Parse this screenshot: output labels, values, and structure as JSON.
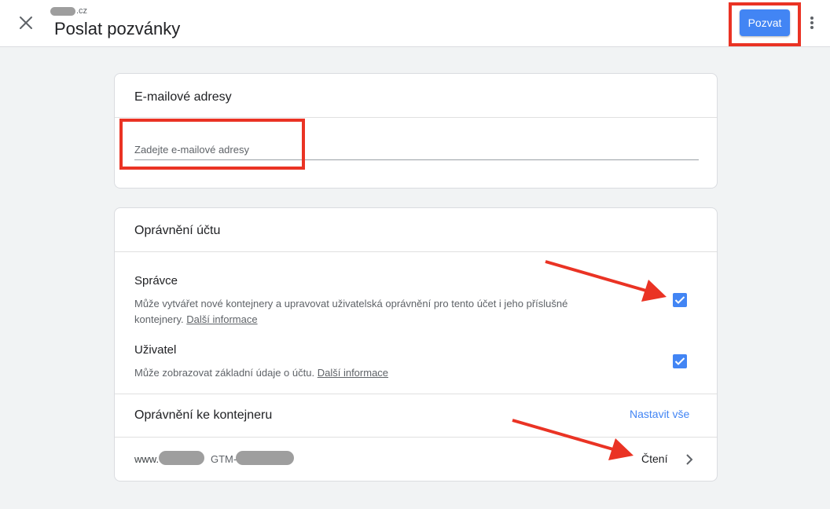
{
  "header": {
    "account_suffix": ".cz",
    "title": "Poslat pozvánky",
    "invite_label": "Pozvat"
  },
  "emails": {
    "title": "E-mailové adresy",
    "placeholder": "Zadejte e-mailové adresy"
  },
  "account_permissions": {
    "title": "Oprávnění účtu",
    "roles": [
      {
        "name": "Správce",
        "description": "Může vytvářet nové kontejnery a upravovat uživatelská oprávnění pro tento účet i jeho příslušné kontejnery.",
        "link": "Další informace",
        "checked": true
      },
      {
        "name": "Uživatel",
        "description": "Může zobrazovat základní údaje o účtu.",
        "link": "Další informace",
        "checked": true
      }
    ]
  },
  "container_permissions": {
    "title": "Oprávnění ke kontejneru",
    "set_all_label": "Nastavit vše",
    "rows": [
      {
        "site_prefix": "www.",
        "gtm_prefix": "GTM-",
        "permission": "Čtení"
      }
    ]
  },
  "colors": {
    "accent": "#4285f4",
    "annotation": "#ea3324"
  },
  "icons": [
    "close-icon",
    "more-vert-icon",
    "check-icon",
    "chevron-right-icon"
  ]
}
